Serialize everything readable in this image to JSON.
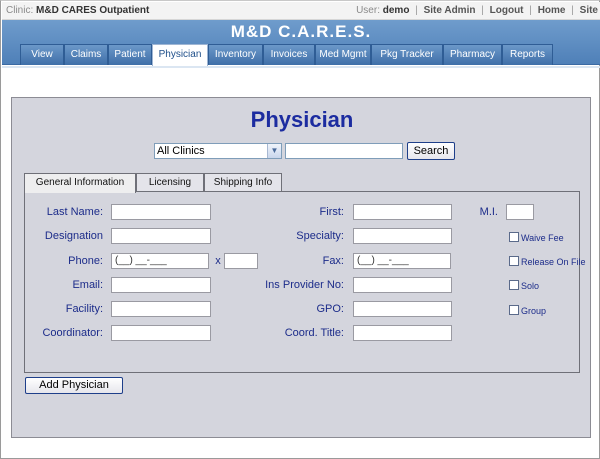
{
  "topbar": {
    "clinic_label": "Clinic:",
    "clinic_name": "M&D CARES Outpatient",
    "user_label": "User:",
    "user_name": "demo",
    "links": [
      "Site Admin",
      "Logout",
      "Home",
      "Site"
    ]
  },
  "header": {
    "title": "M&D C.A.R.E.S.",
    "tabs": [
      "View",
      "Claims",
      "Patient",
      "Physician",
      "Inventory",
      "Invoices",
      "Med Mgmt",
      "Pkg Tracker",
      "Pharmacy",
      "Reports"
    ],
    "active_tab": "Physician"
  },
  "page": {
    "title": "Physician",
    "clinic_filter": "All Clinics",
    "search_value": "",
    "search_button": "Search",
    "form_tabs": [
      "General Information",
      "Licensing",
      "Shipping Info"
    ],
    "active_form_tab": "General Information",
    "add_button": "Add Physician"
  },
  "form": {
    "last_name_label": "Last Name:",
    "designation_label": "Designation",
    "phone_label": "Phone:",
    "phone_value": "(__) __-___",
    "ext_label": "x",
    "email_label": "Email:",
    "facility_label": "Facility:",
    "coordinator_label": "Coordinator:",
    "first_label": "First:",
    "specialty_label": "Specialty:",
    "fax_label": "Fax:",
    "fax_value": "(__) __-___",
    "ins_provider_label": "Ins Provider No:",
    "gpo_label": "GPO:",
    "coord_title_label": "Coord. Title:",
    "mi_label": "M.I.",
    "waive_fee_label": "Waive Fee",
    "release_on_file_label": "Release On File",
    "solo_label": "Solo",
    "group_label": "Group"
  },
  "colors": {
    "header_blue": "#5a89c0",
    "title_navy": "#1c2ca0",
    "label_blue": "#1c2c8a",
    "panel_gray": "#d4d5dd"
  }
}
